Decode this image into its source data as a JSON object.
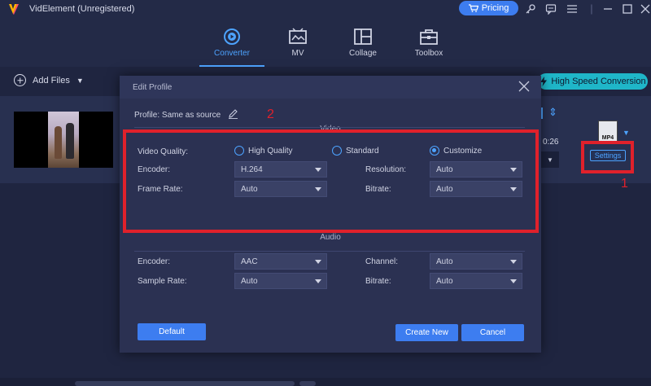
{
  "app": {
    "title": "VidElement (Unregistered)"
  },
  "titlebar": {
    "pricing_label": "Pricing"
  },
  "nav": {
    "items": [
      {
        "label": "Converter",
        "icon": "converter-icon",
        "active": true
      },
      {
        "label": "MV",
        "icon": "mv-icon"
      },
      {
        "label": "Collage",
        "icon": "collage-icon"
      },
      {
        "label": "Toolbox",
        "icon": "toolbox-icon"
      }
    ]
  },
  "toolbar": {
    "add_files_label": "Add Files",
    "high_speed_label": "High Speed Conversion"
  },
  "file": {
    "duration": "0:26",
    "format": "MP4",
    "settings_label": "Settings"
  },
  "annotations": {
    "one": "1",
    "two": "2"
  },
  "modal": {
    "title": "Edit Profile",
    "profile_label": "Profile:",
    "profile_value": "Same as source",
    "video": {
      "heading": "Video",
      "quality_label": "Video Quality:",
      "quality_options": [
        "High Quality",
        "Standard",
        "Customize"
      ],
      "quality_selected": "Customize",
      "encoder_label": "Encoder:",
      "encoder_value": "H.264",
      "resolution_label": "Resolution:",
      "resolution_value": "Auto",
      "framerate_label": "Frame Rate:",
      "framerate_value": "Auto",
      "bitrate_label": "Bitrate:",
      "bitrate_value": "Auto"
    },
    "audio": {
      "heading": "Audio",
      "encoder_label": "Encoder:",
      "encoder_value": "AAC",
      "channel_label": "Channel:",
      "channel_value": "Auto",
      "samplerate_label": "Sample Rate:",
      "samplerate_value": "Auto",
      "bitrate_label": "Bitrate:",
      "bitrate_value": "Auto"
    },
    "buttons": {
      "default": "Default",
      "create_new": "Create New",
      "cancel": "Cancel"
    }
  },
  "colors": {
    "accent": "#3d7df0",
    "highlight": "#e0212b",
    "teal": "#1fb6c8"
  }
}
